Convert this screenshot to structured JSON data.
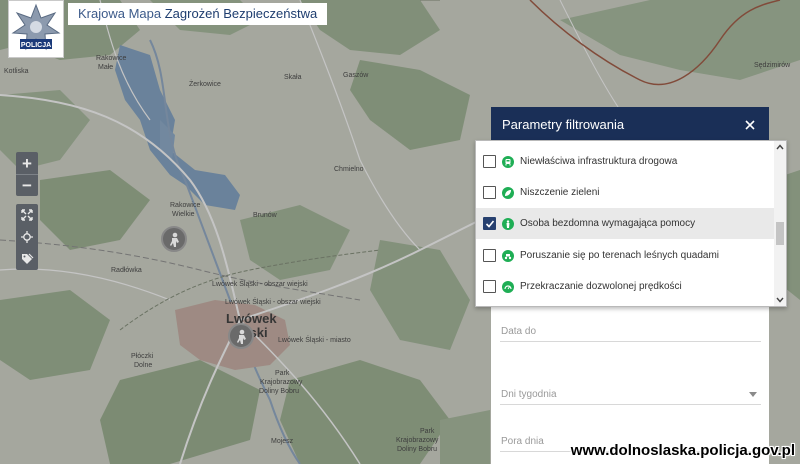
{
  "app": {
    "title_prefix": "Krajowa Mapa ",
    "title_main": "Zagrożeń Bezpieczeństwa",
    "logo_text": "POLICJA"
  },
  "map": {
    "places": {
      "kotliska": "Kotliska",
      "rakowice_male_1": "Rakowice",
      "rakowice_male_2": "Małe",
      "zerkowice": "Żerkowice",
      "skala": "Skała",
      "gaszow": "Gaszów",
      "sedzimirow": "Sędzimirów",
      "chmielno": "Chmielno",
      "rakowice_wielkie_1": "Rakowice",
      "rakowice_wielkie_2": "Wielkie",
      "brunow": "Brunów",
      "radlowka": "Radłówka",
      "lwowek_obszar_1": "Lwówek Śląski - obszar wiejski",
      "lwowek_obszar_2": "Lwówek Śląski - obszar wiejski",
      "lwowek_city_1": "Lwówek",
      "lwowek_city_2": "Śląski",
      "lwowek_miasto": "Lwówek Śląski - miasto",
      "ploczki_1": "Płóczki",
      "ploczki_2": "Dolne",
      "park1_1": "Park",
      "park1_2": "Krajobrazowy",
      "park1_3": "Doliny Bobru",
      "park2_1": "Park",
      "park2_2": "Krajobrazowy",
      "park2_3": "Doliny Bobru",
      "mojesz": "Mojesz"
    }
  },
  "controls": {
    "zoom_in": "+",
    "zoom_out": "−"
  },
  "filter": {
    "title": "Parametry filtrowania",
    "fields": {
      "date_to": "Data do",
      "weekdays": "Dni tygodnia",
      "time_of_day": "Pora dnia"
    },
    "options": [
      {
        "label": "Niewłaściwa infrastruktura drogowa",
        "checked": false
      },
      {
        "label": "Niszczenie zieleni",
        "checked": false
      },
      {
        "label": "Osoba bezdomna wymagająca pomocy",
        "checked": true
      },
      {
        "label": "Poruszanie się po terenach leśnych quadami",
        "checked": false
      },
      {
        "label": "Przekraczanie dozwolonej prędkości",
        "checked": false
      }
    ]
  },
  "watermark": "www.dolnoslaska.policja.gov.pl",
  "colors": {
    "header_bg": "#1a2f57",
    "checkbox_on": "#27406f",
    "category_icon": "#1fae55",
    "title_text": "#1f3a6b"
  }
}
